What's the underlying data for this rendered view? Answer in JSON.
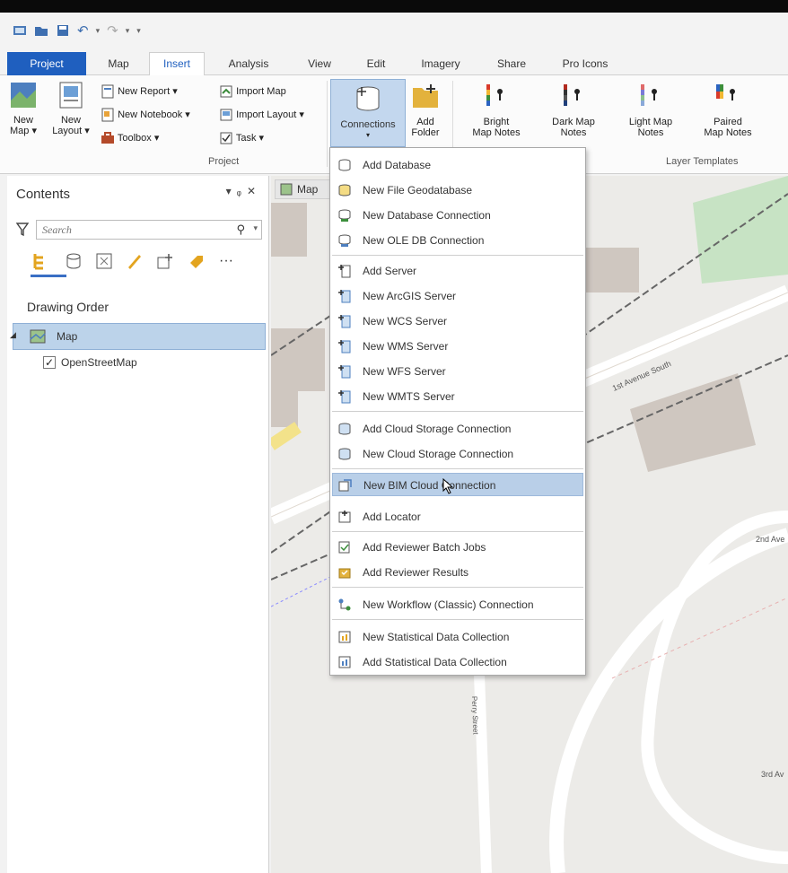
{
  "tabs": [
    {
      "label": "Project"
    },
    {
      "label": "Map"
    },
    {
      "label": "Insert"
    },
    {
      "label": "Analysis"
    },
    {
      "label": "View"
    },
    {
      "label": "Edit"
    },
    {
      "label": "Imagery"
    },
    {
      "label": "Share"
    },
    {
      "label": "Pro Icons"
    }
  ],
  "ribbon": {
    "new_map": "New",
    "new_map_2": "Map",
    "new_layout": "New",
    "new_layout_2": "Layout",
    "new_report": "New Report",
    "new_notebook": "New Notebook",
    "toolbox": "Toolbox",
    "import_map": "Import Map",
    "import_layout": "Import Layout",
    "task": "Task",
    "project_group": "Project",
    "connections": "Connections",
    "add_folder": "Add",
    "add_folder_2": "Folder",
    "bright": "Bright",
    "bright_2": "Map Notes",
    "dark": "Dark Map",
    "dark_2": "Notes",
    "light": "Light Map",
    "light_2": "Notes",
    "paired": "Paired",
    "paired_2": "Map Notes",
    "layer_templates_group": "Layer Templates"
  },
  "contents": {
    "title": "Contents",
    "search_placeholder": "Search",
    "drawing_order": "Drawing Order",
    "map_layer": "Map",
    "basemap_layer": "OpenStreetMap"
  },
  "map_tab": "Map",
  "map_labels": {
    "street_1": "1st Avenue South",
    "street_2": "2nd Ave",
    "street_3": "3rd Av",
    "street_4": "Perry Street"
  },
  "connections_menu": [
    {
      "label": "Add Database"
    },
    {
      "label": "New File Geodatabase"
    },
    {
      "label": "New Database Connection"
    },
    {
      "label": "New OLE DB Connection"
    },
    {
      "label": "Add Server"
    },
    {
      "label": "New ArcGIS Server"
    },
    {
      "label": "New WCS Server"
    },
    {
      "label": "New WMS Server"
    },
    {
      "label": "New WFS Server"
    },
    {
      "label": "New WMTS Server"
    },
    {
      "label": "Add Cloud Storage Connection"
    },
    {
      "label": "New Cloud Storage Connection"
    },
    {
      "label": "New BIM Cloud Connection"
    },
    {
      "label": "Add Locator"
    },
    {
      "label": "Add Reviewer Batch Jobs"
    },
    {
      "label": "Add Reviewer Results"
    },
    {
      "label": "New Workflow (Classic) Connection"
    },
    {
      "label": "New Statistical Data Collection"
    },
    {
      "label": "Add Statistical Data Collection"
    }
  ],
  "colors": {
    "accent": "#1f5fbf",
    "highlight": "#b9cfe8",
    "map_bg": "#ecebe8"
  }
}
